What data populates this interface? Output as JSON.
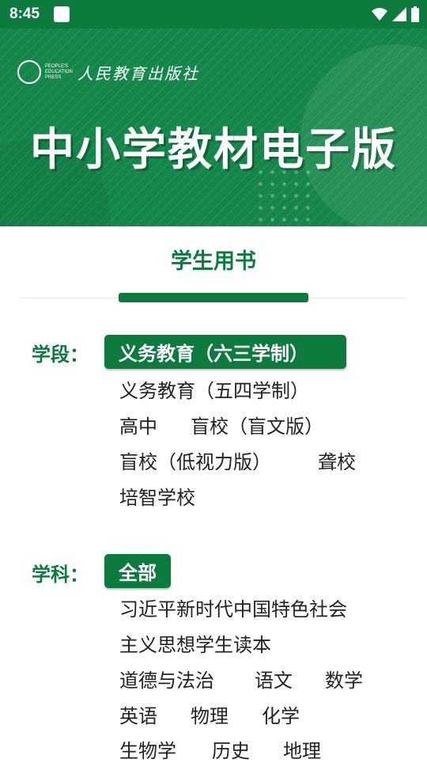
{
  "status_bar": {
    "time": "8:45",
    "icons": [
      "wifi-icon",
      "signal-icon",
      "battery-icon"
    ]
  },
  "banner": {
    "publisher_en": [
      "PEOPLE'S",
      "EDUCATION",
      "PRESS"
    ],
    "publisher_cn": "人民教育出版社",
    "title": "中小学教材电子版"
  },
  "section": {
    "title": "学生用书"
  },
  "stage": {
    "label": "学段：",
    "options": [
      "义务教育（六三学制）",
      "义务教育（五四学制）",
      "高中",
      "盲校（盲文版）",
      "盲校（低视力版）",
      "聋校",
      "培智学校"
    ],
    "selected": "义务教育（六三学制）"
  },
  "subject": {
    "label": "学科：",
    "options": [
      "全部",
      "习近平新时代中国特色社会",
      "主义思想学生读本",
      "道德与法治",
      "语文",
      "数学",
      "英语",
      "物理",
      "化学",
      "生物学",
      "历史",
      "地理"
    ],
    "selected": "全部"
  },
  "colors": {
    "primary": "#0d7a3e",
    "banner": "#15864a",
    "text": "#222222"
  }
}
